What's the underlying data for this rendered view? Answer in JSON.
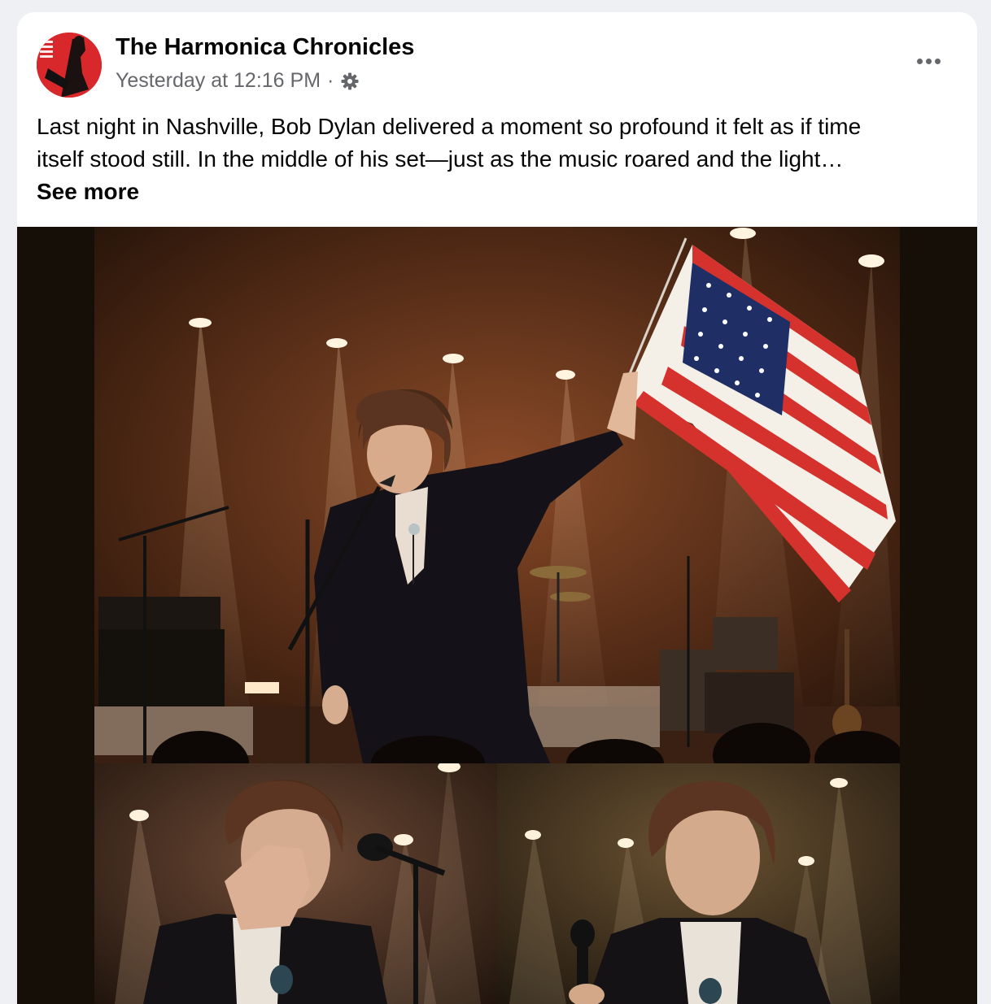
{
  "post": {
    "page_name": "The Harmonica Chronicles",
    "timestamp": "Yesterday at 12:16 PM",
    "separator": "·",
    "audience_icon": "gear-icon",
    "more_icon": "more-horizontal-icon",
    "text_line_1": "Last night in Nashville, Bob Dylan delivered a moment so profound it felt as if time",
    "text_line_2": "itself stood still. In the middle of his set—just as the music roared and the light…",
    "see_more": "See more"
  },
  "media": {
    "photos": [
      {
        "subject": "performer-holding-american-flag-on-stage"
      },
      {
        "subject": "performer-hand-on-face-at-microphone"
      },
      {
        "subject": "performer-emotional-holding-microphone"
      }
    ]
  },
  "colors": {
    "primary_text": "#050505",
    "secondary_text": "#65676b",
    "card_bg": "#ffffff",
    "page_bg": "#eef0f3",
    "avatar_red": "#d8282c"
  }
}
